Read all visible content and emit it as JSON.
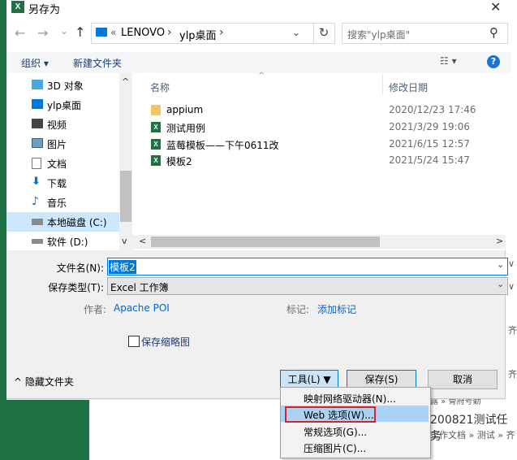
{
  "window": {
    "title": "另存为",
    "close": "✕",
    "app_icon": "X"
  },
  "nav": {
    "back": "←",
    "forward": "→",
    "up": "↑",
    "dropdown": "⌄",
    "breadcrumb": [
      "«",
      "LENOVO",
      "›",
      "ylp桌面",
      "›"
    ],
    "refresh": "↻",
    "search_placeholder": "搜索\"ylp桌面\"",
    "search_icon": "⚲"
  },
  "toolbar": {
    "organize": "组织 ▾",
    "new_folder": "新建文件夹",
    "view": "☷ ▾",
    "help": "?"
  },
  "sidebar": {
    "items": [
      {
        "label": "3D 对象",
        "icon": "3d-objects-icon"
      },
      {
        "label": "ylp桌面",
        "icon": "desktop-icon"
      },
      {
        "label": "视频",
        "icon": "video-icon"
      },
      {
        "label": "图片",
        "icon": "pictures-icon"
      },
      {
        "label": "文档",
        "icon": "documents-icon"
      },
      {
        "label": "下载",
        "icon": "download-icon"
      },
      {
        "label": "音乐",
        "icon": "music-icon"
      },
      {
        "label": "本地磁盘 (C:)",
        "icon": "local-disk-icon",
        "selected": true
      },
      {
        "label": "软件 (D:)",
        "icon": "drive-icon"
      }
    ],
    "scroll_up": "^",
    "scroll_down": "v"
  },
  "filelist": {
    "columns": {
      "name": "名称",
      "modified": "修改日期"
    },
    "rows": [
      {
        "name": "appium",
        "date": "2020/12/23 17:46",
        "type": "folder"
      },
      {
        "name": "测试用例",
        "date": "2021/3/29 19:06",
        "type": "excel"
      },
      {
        "name": "蓝莓模板——下午0611改",
        "date": "2021/6/15 12:57",
        "type": "excel"
      },
      {
        "name": "模板2",
        "date": "2021/5/24 15:47",
        "type": "excel"
      }
    ],
    "hscroll_left": "<",
    "hscroll_right": ">"
  },
  "form": {
    "filename_label": "文件名(N):",
    "filename_value": "模板2",
    "filetype_label": "保存类型(T):",
    "filetype_value": "Excel 工作簿",
    "author_label": "作者:",
    "author_value": "Apache POI",
    "tags_label": "标记:",
    "tags_value": "添加标记",
    "thumbnail_label": "保存缩略图",
    "dropdown_glyph": "⌄"
  },
  "footer": {
    "hide_folders": "^ 隐藏文件夹",
    "tools": "工具(L) ▼",
    "save": "保存(S)",
    "cancel": "取消"
  },
  "tools_menu": {
    "items": [
      "映射网络驱动器(N)...",
      "Web 选项(W)...",
      "常规选项(G)...",
      "压缩图片(C)..."
    ],
    "selected_index": 1
  },
  "background": {
    "right_glyphs": [
      "∨",
      "∨",
      "齐",
      "齐"
    ],
    "bottom_texts": [
      "露 » 骨府号勤",
      "200821测试任务",
      "工作文档 » 测试 » 齐"
    ]
  },
  "colors": {
    "excel_green": "#1e7145",
    "selection": "#cce8ff",
    "menu_highlight": "#a9d2f5",
    "highlight_box": "#d8232a",
    "link": "#0066cc"
  }
}
